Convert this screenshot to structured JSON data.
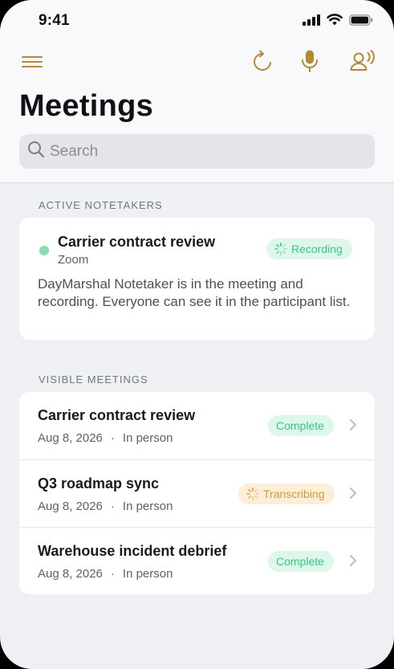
{
  "status": {
    "time": "9:41"
  },
  "header": {
    "title": "Meetings"
  },
  "search": {
    "placeholder": "Search"
  },
  "active_section": {
    "label": "ACTIVE NOTETAKERS",
    "item": {
      "title": "Carrier contract review",
      "platform": "Zoom",
      "status": "Recording",
      "description": "DayMarshal Notetaker is in the meeting and recording. Everyone can see it in the participant list."
    }
  },
  "visible_section": {
    "label": "VISIBLE MEETINGS",
    "meetings": [
      {
        "title": "Carrier contract review",
        "date": "Aug 8, 2026",
        "separator": "·",
        "location": "In person",
        "status": "Complete"
      },
      {
        "title": "Q3 roadmap sync",
        "date": "Aug 8, 2026",
        "separator": "·",
        "location": "In person",
        "status": "Transcribing"
      },
      {
        "title": "Warehouse incident debrief",
        "date": "Aug 8, 2026",
        "separator": "·",
        "location": "In person",
        "status": "Complete"
      }
    ]
  },
  "icons": {
    "menu": "hamburger-menu-icon",
    "refresh": "refresh-icon",
    "mic": "microphone-icon",
    "voice": "voice-profile-icon",
    "search": "search-icon",
    "chevron": "chevron-right-icon"
  },
  "colors": {
    "accent": "#b58a2e",
    "success": "#3cc585",
    "warning": "#d99a34",
    "live_dot": "#86ddb3"
  }
}
